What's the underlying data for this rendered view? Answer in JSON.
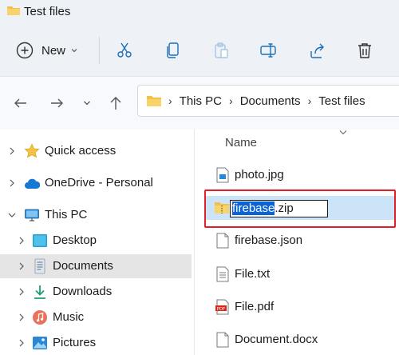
{
  "window": {
    "title": "Test files"
  },
  "toolbar": {
    "new_label": "New",
    "tools": [
      "cut-icon",
      "copy-icon",
      "paste-icon",
      "rename-icon",
      "share-icon",
      "delete-icon"
    ]
  },
  "address": {
    "crumbs": [
      "This PC",
      "Documents",
      "Test files"
    ]
  },
  "sidebar": {
    "items": [
      {
        "label": "Quick access",
        "icon": "star-icon"
      },
      {
        "label": "OneDrive - Personal",
        "icon": "cloud-icon"
      },
      {
        "label": "This PC",
        "icon": "computer-icon"
      },
      {
        "label": "Desktop",
        "icon": "desktop-icon"
      },
      {
        "label": "Documents",
        "icon": "documents-icon",
        "selected": true
      },
      {
        "label": "Downloads",
        "icon": "download-icon"
      },
      {
        "label": "Music",
        "icon": "music-icon"
      },
      {
        "label": "Pictures",
        "icon": "pictures-icon"
      }
    ]
  },
  "filelist": {
    "column_name": "Name",
    "rename": {
      "selected_part": "firebase",
      "rest": ".zip"
    },
    "files": [
      "photo.jpg",
      "firebase.zip",
      "firebase.json",
      "File.txt",
      "File.pdf",
      "Document.docx"
    ]
  },
  "colors": {
    "accent": "#0a64d6",
    "selection_row": "#cce4f7",
    "highlight_outline": "#e0202a",
    "sidebar_selected": "#e5e5e5"
  }
}
